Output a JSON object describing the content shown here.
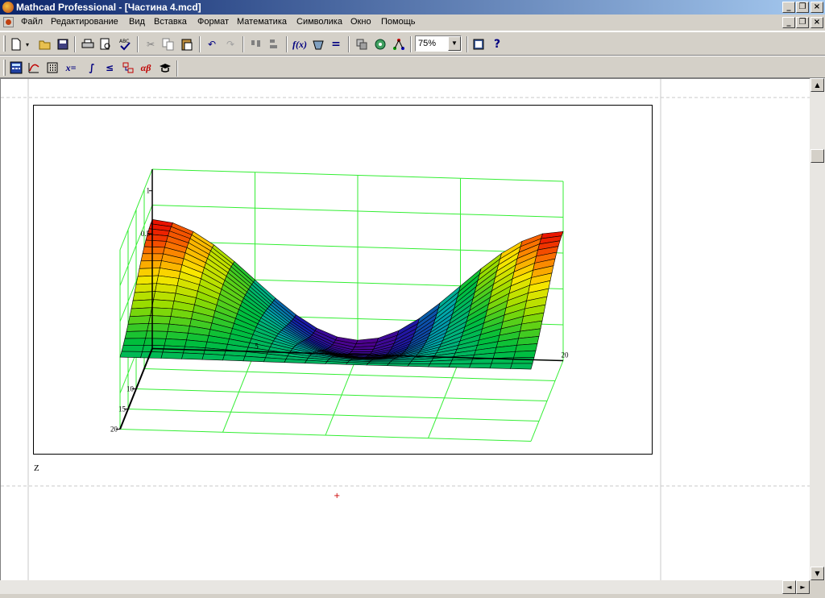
{
  "window": {
    "title": "Mathcad Professional - [Частина 4.mcd]",
    "minimize_glyph": "_",
    "restore_glyph": "❐",
    "close_glyph": "×"
  },
  "menu": [
    "Файл",
    "Редактирование",
    "Вид",
    "Вставка",
    "Формат",
    "Математика",
    "Символика",
    "Окно",
    "Помощь"
  ],
  "toolbar": {
    "zoom": "75%",
    "standard_icons": [
      "new-doc-icon",
      "dropdown-arrow-icon",
      "open-folder-icon",
      "save-icon",
      "print-icon",
      "print-preview-icon",
      "spellcheck-icon",
      "cut-icon",
      "copy-icon",
      "paste-icon",
      "undo-icon",
      "redo-icon",
      "align-horizontal-icon",
      "align-vertical-icon",
      "insert-function-icon",
      "insert-unit-icon",
      "calculate-icon",
      "insert-component-icon",
      "resource-center-icon",
      "insert-hyperlink-icon",
      "zoom-dropdown",
      "book-icon",
      "help-icon"
    ],
    "math_icons": [
      "calculator-toolbar-icon",
      "graph-toolbar-icon",
      "matrix-toolbar-icon",
      "evaluation-toolbar-icon",
      "calculus-toolbar-icon",
      "boolean-toolbar-icon",
      "programming-toolbar-icon",
      "greek-toolbar-icon",
      "symbolic-toolbar-icon"
    ]
  },
  "math_toolbar_glyphs": {
    "evaluation": "x=",
    "calculus": "∫",
    "boolean": "≤",
    "greek": "αβ"
  },
  "plot": {
    "z_ticks": [
      "1",
      "0.5"
    ],
    "y_ticks": [
      "10",
      "15",
      "20"
    ],
    "x_ticks": [
      "5",
      "20"
    ],
    "surface_label": "Z",
    "colors": {
      "grid": "#33ee33",
      "axis": "#000000",
      "mesh": "#000000"
    }
  },
  "scroll_glyphs": {
    "up": "▲",
    "down": "▼",
    "left": "◄",
    "right": "►"
  }
}
